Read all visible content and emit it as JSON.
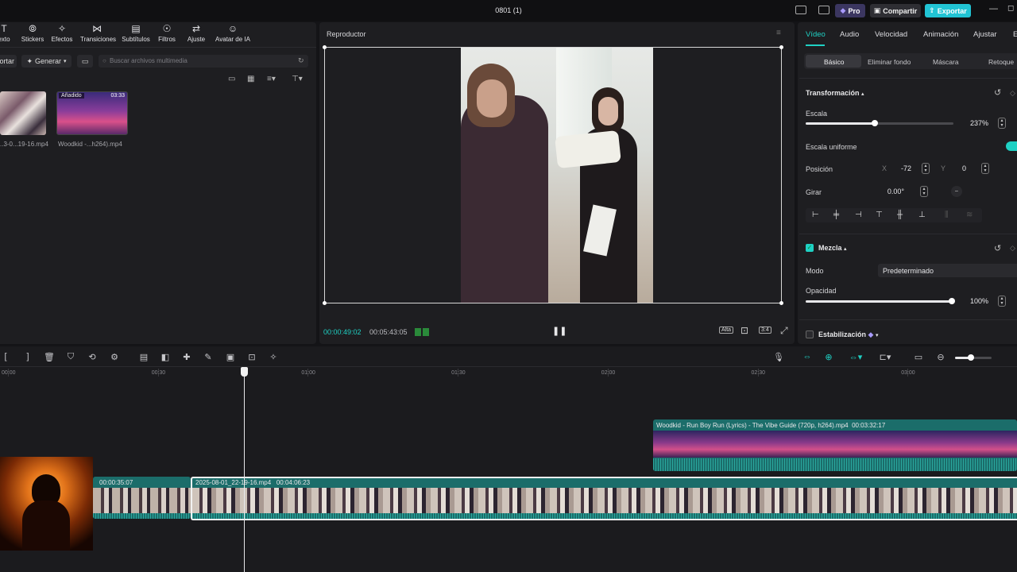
{
  "window": {
    "title": "0801 (1)"
  },
  "titlebar": {
    "pro": "Pro",
    "share": "Compartir",
    "export": "Exportar"
  },
  "toolbar": {
    "items": [
      "exto",
      "Stickers",
      "Efectos",
      "Transiciones",
      "Subtítulos",
      "Filtros",
      "Ajuste",
      "Avatar de IA"
    ]
  },
  "media": {
    "import_label": "ortar",
    "generate_label": "Generar",
    "search_placeholder": "Buscar archivos multimedia",
    "items": [
      {
        "name": "..3-0...19-16.mp4"
      },
      {
        "name": "Woodkid -...h264).mp4",
        "badge": "Añadido",
        "duration": "03:33"
      }
    ]
  },
  "player": {
    "title": "Reproductor",
    "current_time": "00:00:49:02",
    "total_time": "00:05:43:05",
    "quality": "Alta",
    "ratio": "3:4"
  },
  "inspector": {
    "tabs": [
      "Vídeo",
      "Audio",
      "Velocidad",
      "Animación",
      "Ajustar",
      "E"
    ],
    "subtabs": [
      "Básico",
      "Eliminar fondo",
      "Máscara",
      "Retoque"
    ],
    "transform_title": "Transformación",
    "scale_label": "Escala",
    "scale_value": "237%",
    "scale_fraction": 0.47,
    "uniform_label": "Escala uniforme",
    "position_label": "Posición",
    "pos_x_label": "X",
    "pos_x": "-72",
    "pos_y_label": "Y",
    "pos_y": "0",
    "rotate_label": "Girar",
    "rotate_value": "0.00°",
    "blend_title": "Mezcla",
    "mode_label": "Modo",
    "mode_value": "Predeterminado",
    "opacity_label": "Opacidad",
    "opacity_value": "100%",
    "opacity_fraction": 1.0,
    "stabilize_label": "Estabilización"
  },
  "timeline": {
    "ruler": [
      "00:00",
      "00:30",
      "01:00",
      "01:30",
      "02:00",
      "02:30",
      "03:00"
    ],
    "audio_clip": {
      "name": "Woodkid - Run Boy Run (Lyrics) - The Vibe Guide (720p, h264).mp4",
      "duration": "00:03:32:17"
    },
    "clip_a": {
      "duration": "00:00:35:07"
    },
    "clip_b": {
      "name": "2025-08-01_22-19-16.mp4",
      "duration": "00:04:06:23"
    }
  },
  "colors": {
    "accent": "#1fd1c4",
    "export": "#21c4d4",
    "pro": "#6d5bd6",
    "clip_teal": "#1b6d6a"
  }
}
